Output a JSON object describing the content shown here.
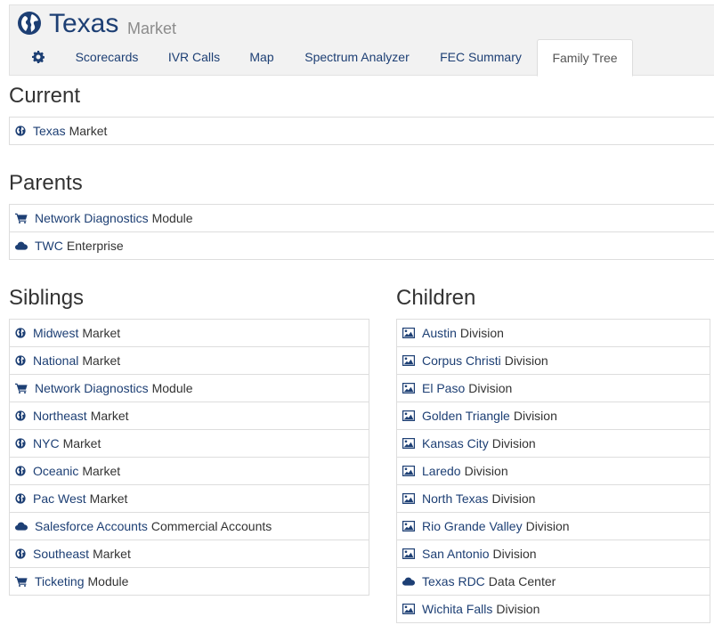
{
  "header": {
    "title": "Texas",
    "subtitle": "Market",
    "tabs": [
      {
        "label": "Scorecards"
      },
      {
        "label": "IVR Calls"
      },
      {
        "label": "Map"
      },
      {
        "label": "Spectrum Analyzer"
      },
      {
        "label": "FEC Summary"
      },
      {
        "label": "Family Tree",
        "active": true
      }
    ]
  },
  "current": {
    "heading": "Current",
    "items": [
      {
        "icon": "globe-icon",
        "link": "Texas",
        "suffix": "Market"
      }
    ]
  },
  "parents": {
    "heading": "Parents",
    "items": [
      {
        "icon": "cart-icon",
        "link": "Network Diagnostics",
        "suffix": "Module"
      },
      {
        "icon": "cloud-icon",
        "link": "TWC",
        "suffix": "Enterprise"
      }
    ]
  },
  "siblings": {
    "heading": "Siblings",
    "items": [
      {
        "icon": "globe-icon",
        "link": "Midwest",
        "suffix": "Market"
      },
      {
        "icon": "globe-icon",
        "link": "National",
        "suffix": "Market"
      },
      {
        "icon": "cart-icon",
        "link": "Network Diagnostics",
        "suffix": "Module"
      },
      {
        "icon": "globe-icon",
        "link": "Northeast",
        "suffix": "Market"
      },
      {
        "icon": "globe-icon",
        "link": "NYC",
        "suffix": "Market"
      },
      {
        "icon": "globe-icon",
        "link": "Oceanic",
        "suffix": "Market"
      },
      {
        "icon": "globe-icon",
        "link": "Pac West",
        "suffix": "Market"
      },
      {
        "icon": "cloud-icon",
        "link": "Salesforce Accounts",
        "suffix": "Commercial Accounts"
      },
      {
        "icon": "globe-icon",
        "link": "Southeast",
        "suffix": "Market"
      },
      {
        "icon": "cart-icon",
        "link": "Ticketing",
        "suffix": "Module"
      }
    ]
  },
  "children": {
    "heading": "Children",
    "items": [
      {
        "icon": "picture-icon",
        "link": "Austin",
        "suffix": "Division"
      },
      {
        "icon": "picture-icon",
        "link": "Corpus Christi",
        "suffix": "Division"
      },
      {
        "icon": "picture-icon",
        "link": "El Paso",
        "suffix": "Division"
      },
      {
        "icon": "picture-icon",
        "link": "Golden Triangle",
        "suffix": "Division"
      },
      {
        "icon": "picture-icon",
        "link": "Kansas City",
        "suffix": "Division"
      },
      {
        "icon": "picture-icon",
        "link": "Laredo",
        "suffix": "Division"
      },
      {
        "icon": "picture-icon",
        "link": "North Texas",
        "suffix": "Division"
      },
      {
        "icon": "picture-icon",
        "link": "Rio Grande Valley",
        "suffix": "Division"
      },
      {
        "icon": "picture-icon",
        "link": "San Antonio",
        "suffix": "Division"
      },
      {
        "icon": "cloud-icon",
        "link": "Texas RDC",
        "suffix": "Data Center"
      },
      {
        "icon": "picture-icon",
        "link": "Wichita Falls",
        "suffix": "Division"
      }
    ]
  },
  "colors": {
    "link": "#1d3f74",
    "text": "#333333",
    "header_bg": "#f2f2f2",
    "border": "#dddddd"
  }
}
